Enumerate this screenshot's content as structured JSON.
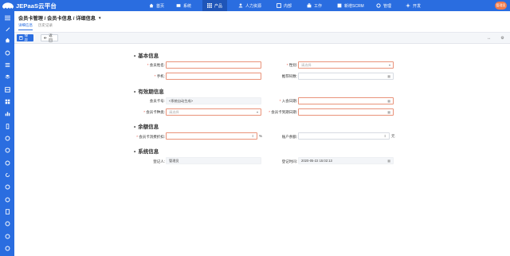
{
  "app": {
    "title": "JEPaaS云平台",
    "user_avatar": "管理员"
  },
  "nav": [
    {
      "label": "首页",
      "icon": "home-icon"
    },
    {
      "label": "系统",
      "icon": "system-icon"
    },
    {
      "label": "产品",
      "icon": "grid-icon"
    },
    {
      "label": "人力资源",
      "icon": "people-icon"
    },
    {
      "label": "内部",
      "icon": "internal-icon"
    },
    {
      "label": "工作",
      "icon": "work-icon"
    },
    {
      "label": "新增SCRM",
      "icon": "scrm-icon"
    },
    {
      "label": "管理",
      "icon": "manage-icon"
    },
    {
      "label": "开发",
      "icon": "dev-icon"
    }
  ],
  "page": {
    "breadcrumb": "会员卡管理 / 会员卡信息 / 详细信息",
    "tabs": [
      "详细信息",
      "历史记录"
    ]
  },
  "toolbar": {
    "save_label": "保存",
    "back_label": "返回"
  },
  "sections": {
    "basic": "基本信息",
    "validity": "有效期信息",
    "balance": "余额信息",
    "system": "系统信息"
  },
  "fields": {
    "member_name": {
      "label": "会员姓名:",
      "value": ""
    },
    "gender": {
      "label": "性别:",
      "placeholder": "请选择"
    },
    "phone": {
      "label": "手机:",
      "value": ""
    },
    "referral_code": {
      "label": "推荐码数:",
      "value": ""
    },
    "card_no": {
      "label": "会员卡号:",
      "value": "<系统自动生成>"
    },
    "join_date": {
      "label": "入会日期:",
      "value": ""
    },
    "card_type": {
      "label": "会员卡种类:",
      "placeholder": "请选择"
    },
    "expiry_date": {
      "label": "会员卡到期日期:",
      "value": ""
    },
    "discount": {
      "label": "会员卡消费折扣:",
      "unit": "%"
    },
    "balance": {
      "label": "账户余额:",
      "unit": "元"
    },
    "registrant": {
      "label": "登记人:",
      "value": "管理员"
    },
    "register_time": {
      "label": "登记时间:",
      "value": "2020-05-22 15:02:13"
    }
  }
}
